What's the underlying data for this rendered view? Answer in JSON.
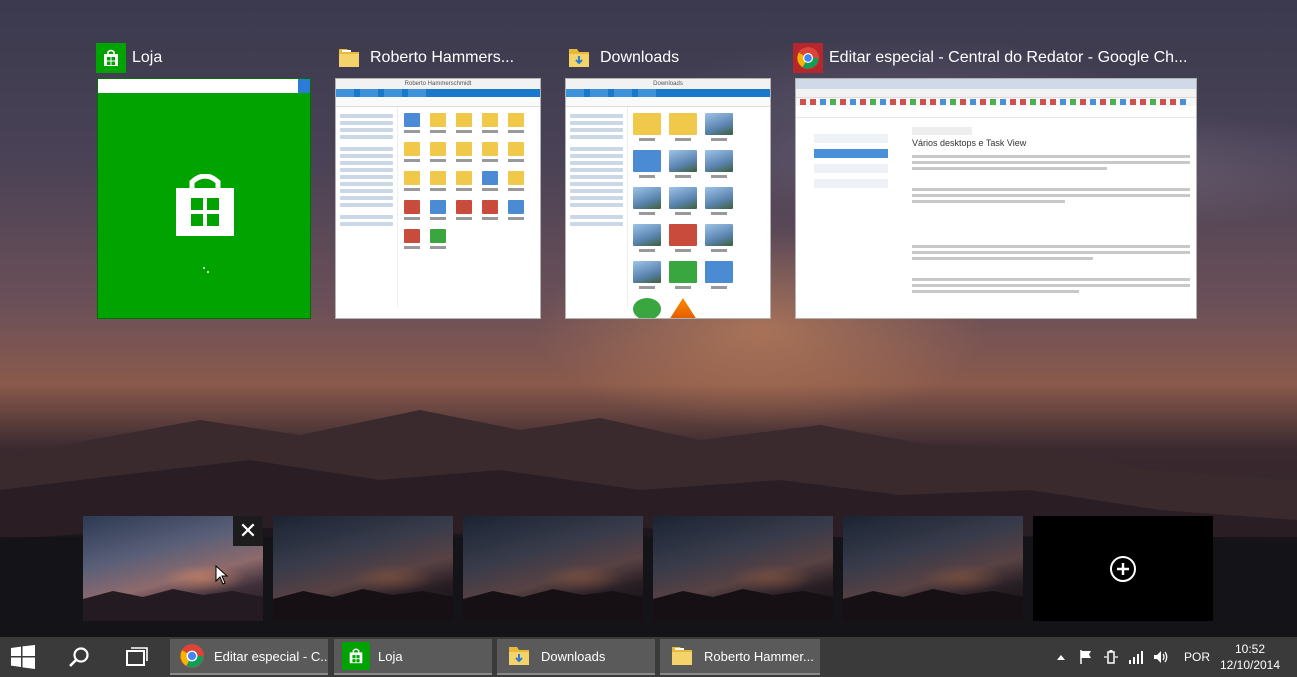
{
  "windows": [
    {
      "title": "Loja",
      "icon": "store-icon"
    },
    {
      "title": "Roberto Hammers...",
      "icon": "folder-icon",
      "window_title": "Roberto Hammerschmidt"
    },
    {
      "title": "Downloads",
      "icon": "folder-icon",
      "window_title": "Downloads"
    },
    {
      "title": "Editar especial - Central do Redator - Google Ch...",
      "icon": "chrome-icon",
      "article_heading": "Vários desktops e Task View"
    }
  ],
  "desktops": {
    "count": 5,
    "close_symbol": "✕",
    "new_desktop_icon": "plus-circle-icon"
  },
  "taskbar": {
    "apps": [
      {
        "label": "Editar especial - C...",
        "icon": "chrome-icon"
      },
      {
        "label": "Loja",
        "icon": "store-icon"
      },
      {
        "label": "Downloads",
        "icon": "folder-icon"
      },
      {
        "label": "Roberto Hammer...",
        "icon": "folder-icon"
      }
    ],
    "language": "POR",
    "time": "10:52",
    "date": "12/10/2014"
  },
  "colors": {
    "store_green": "#00a300",
    "taskbar": "#3a3a3a",
    "taskbar_active": "#5a5a5a"
  }
}
